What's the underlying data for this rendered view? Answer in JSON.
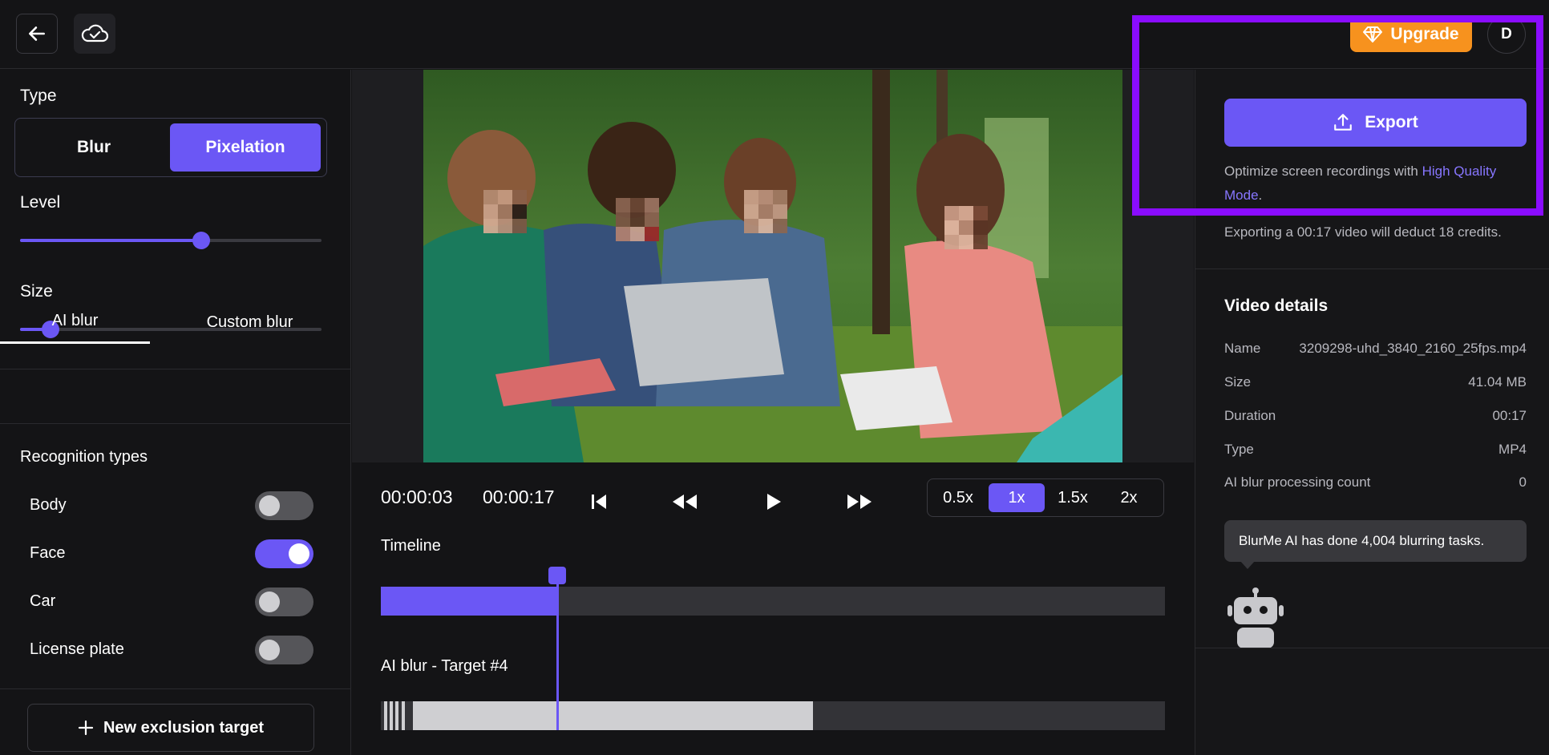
{
  "header": {
    "upgrade_label": "Upgrade",
    "avatar_initial": "D"
  },
  "left_panel": {
    "type_label": "Type",
    "type_options": [
      "Blur",
      "Pixelation"
    ],
    "type_selected": "Pixelation",
    "level_label": "Level",
    "level_value": 0.6,
    "size_label": "Size",
    "size_value": 0.1,
    "tabs": [
      "AI blur",
      "Custom blur"
    ],
    "active_tab": "AI blur",
    "recognition_title": "Recognition types",
    "recognition_types": [
      {
        "label": "Body",
        "enabled": false
      },
      {
        "label": "Face",
        "enabled": true
      },
      {
        "label": "Car",
        "enabled": false
      },
      {
        "label": "License plate",
        "enabled": false
      }
    ],
    "new_target_label": "New exclusion target"
  },
  "player": {
    "current_time": "00:00:03",
    "total_time": "00:00:17",
    "speeds": [
      "0.5x",
      "1x",
      "1.5x",
      "2x"
    ],
    "active_speed": "1x",
    "timeline_label": "Timeline",
    "target_label": "AI blur - Target #4"
  },
  "right_panel": {
    "export_label": "Export",
    "hq_text": "Optimize screen recordings with ",
    "hq_link": "High Quality Mode",
    "hq_suffix": ".",
    "credit_note": "Exporting a 00:17 video will deduct 18 credits.",
    "details_title": "Video details",
    "details": [
      {
        "key": "Name",
        "value": "3209298-uhd_3840_2160_25fps.mp4"
      },
      {
        "key": "Size",
        "value": "41.04 MB"
      },
      {
        "key": "Duration",
        "value": "00:17"
      },
      {
        "key": "Type",
        "value": "MP4"
      },
      {
        "key": "AI blur processing count",
        "value": "0"
      }
    ],
    "tooltip": "BlurMe AI has done 4,004 blurring tasks."
  },
  "colors": {
    "accent": "#6b57f5",
    "upgrade": "#f7921e",
    "highlight": "#8a0cff"
  }
}
